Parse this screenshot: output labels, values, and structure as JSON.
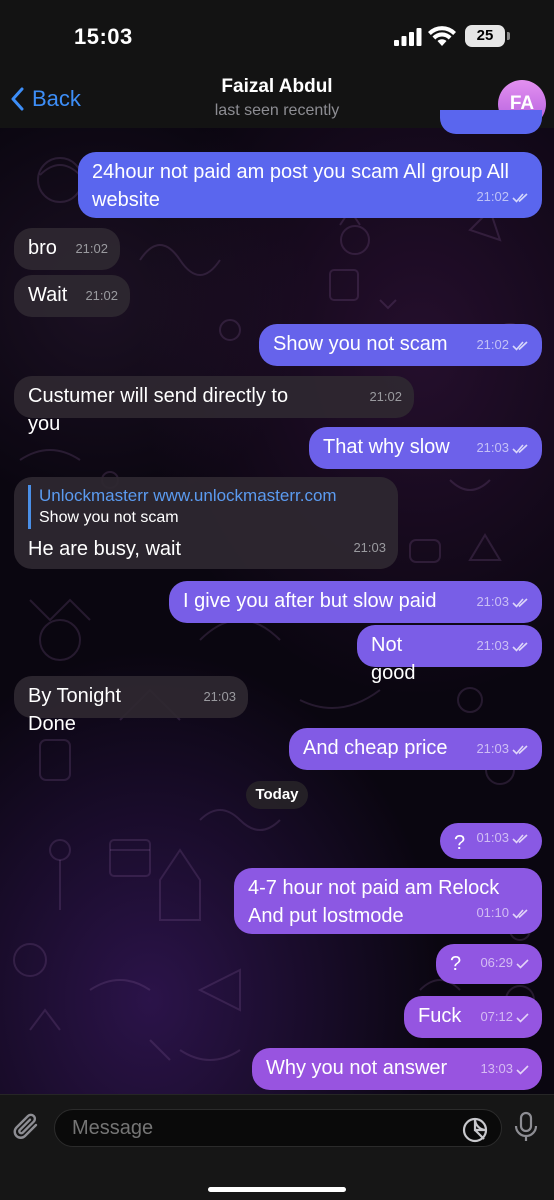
{
  "status_bar": {
    "time": "15:03",
    "battery": "25"
  },
  "header": {
    "back_label": "Back",
    "title": "Faizal Abdul",
    "subtitle": "last seen recently",
    "avatar_initials": "FA"
  },
  "messages": [
    {
      "dir": "out",
      "text": "24hour not paid am post you scam All group All website",
      "time": "21:02",
      "status": "read"
    },
    {
      "dir": "in",
      "text": "bro",
      "time": "21:02"
    },
    {
      "dir": "in",
      "text": "Wait",
      "time": "21:02"
    },
    {
      "dir": "out",
      "text": "Show you not scam",
      "time": "21:02",
      "status": "read"
    },
    {
      "dir": "in",
      "text": "Custumer will send directly to you",
      "time": "21:02"
    },
    {
      "dir": "out",
      "text": "That why slow",
      "time": "21:03",
      "status": "read"
    },
    {
      "dir": "in",
      "text": "He are busy, wait",
      "time": "21:03",
      "reply_to": {
        "author": "Unlockmasterr www.unlockmasterr.com",
        "text": "Show you not scam"
      }
    },
    {
      "dir": "out",
      "text": "I give you after but slow paid",
      "time": "21:03",
      "status": "read"
    },
    {
      "dir": "out",
      "text": "Not good",
      "time": "21:03",
      "status": "read"
    },
    {
      "dir": "in",
      "text": "By Tonight Done",
      "time": "21:03"
    },
    {
      "dir": "out",
      "text": "And cheap price",
      "time": "21:03",
      "status": "read"
    },
    {
      "dir": "out",
      "text": "?",
      "time": "01:03",
      "status": "read"
    },
    {
      "dir": "out",
      "text": "4-7 hour not paid am Relock And put lostmode",
      "time": "01:10",
      "status": "read"
    },
    {
      "dir": "out",
      "text": "?",
      "time": "06:29",
      "status": "sent"
    },
    {
      "dir": "out",
      "text": "Fuck",
      "time": "07:12",
      "status": "sent"
    },
    {
      "dir": "out",
      "text": "Why you not answer",
      "time": "13:03",
      "status": "sent"
    }
  ],
  "date_separator": "Today",
  "input": {
    "placeholder": "Message"
  },
  "colors": {
    "accent": "#3d8ef7",
    "outgoing_top": "#5a66ee",
    "outgoing_bottom": "#9a54e0",
    "incoming": "#2e2830"
  }
}
